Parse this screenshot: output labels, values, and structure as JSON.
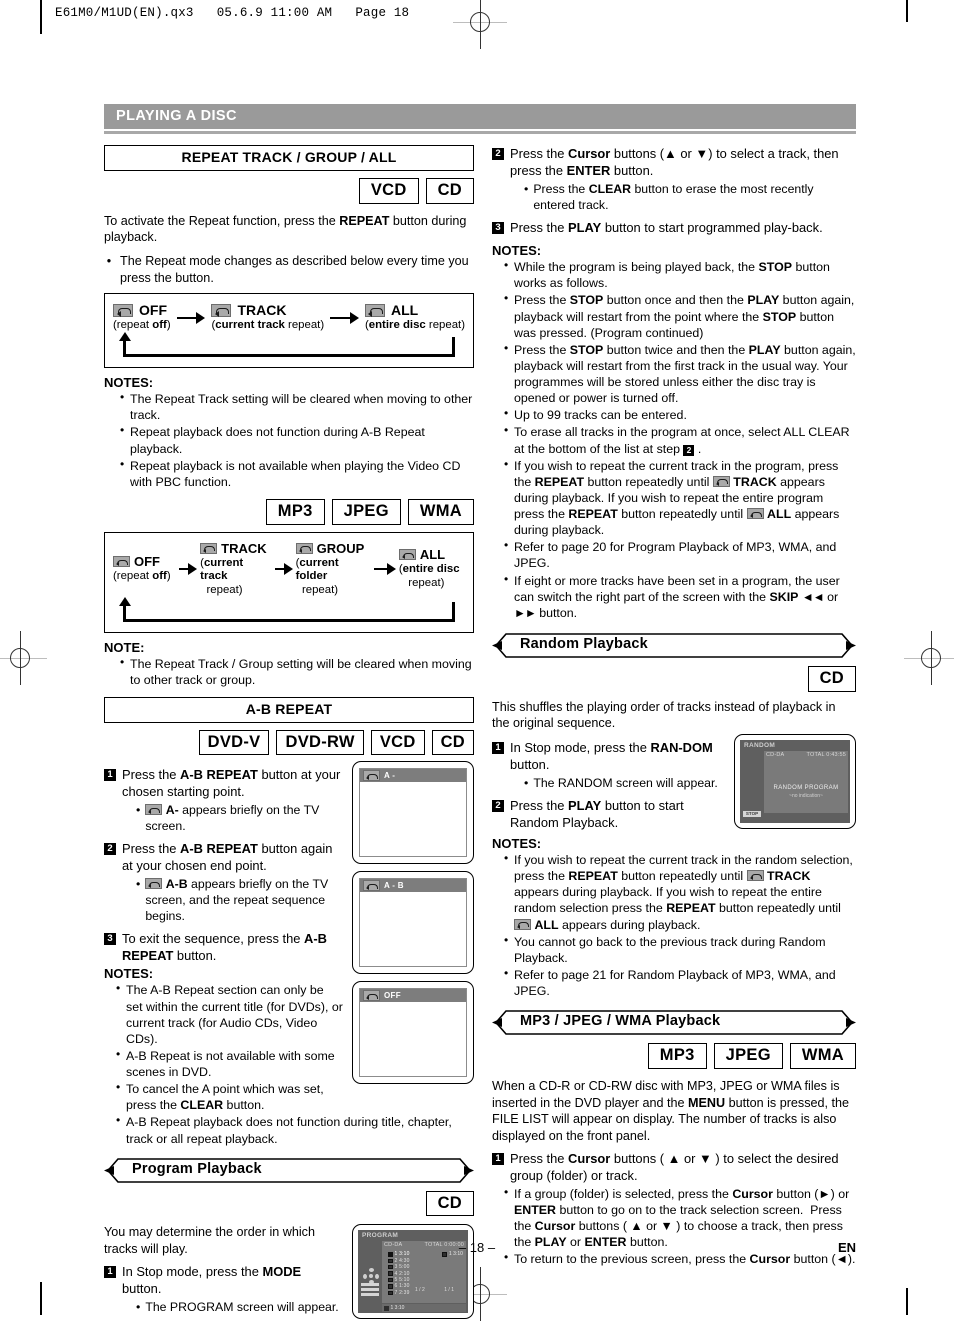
{
  "print_header": "E61M0/M1UD(EN).qx3   05.6.9 11:00 AM   Page 18",
  "section_bar": {
    "title": "PLAYING A DISC"
  },
  "footer": {
    "page_number": "– 18 –",
    "language": "EN"
  },
  "left_column": {
    "repeat": {
      "title": "REPEAT TRACK / GROUP / ALL",
      "chips": [
        "VCD",
        "CD"
      ],
      "intro_before": "To activate the Repeat function, press the ",
      "intro_bold": "REPEAT",
      "intro_after": " button during playback.",
      "bullet": "The Repeat mode changes as described below every time you press the button.",
      "flow_disc": [
        {
          "label": "OFF",
          "sub_bold": "",
          "sub_plain": "(repeat ",
          "sub_bold2": "off",
          "sub_tail": ")"
        },
        {
          "label": "TRACK",
          "sub_plain": "(",
          "sub_bold2": "current track",
          "sub_tail": " repeat)"
        },
        {
          "label": "ALL",
          "sub_plain": "(",
          "sub_bold2": "entire disc",
          "sub_tail": " repeat)"
        }
      ],
      "notes_label": "NOTES:",
      "notes": [
        "The Repeat Track setting will be cleared when moving to other track.",
        "Repeat playback does not function during A-B Repeat playback.",
        "Repeat playback is not available when playing the Video CD with PBC function."
      ],
      "chips2": [
        "MP3",
        "JPEG",
        "WMA"
      ],
      "flow_files": [
        {
          "label": "OFF",
          "sub_pre": "(repeat ",
          "sub_bold": "off",
          "sub_post": ")"
        },
        {
          "label": "TRACK",
          "sub_pre": "(",
          "sub_bold": "current track",
          "sub_post": " repeat)"
        },
        {
          "label": "GROUP",
          "sub_pre": "(",
          "sub_bold": "current folder",
          "sub_post": " repeat)"
        },
        {
          "label": "ALL",
          "sub_pre": "(",
          "sub_bold": "entire disc",
          "sub_post": " repeat)"
        }
      ],
      "note_label2": "NOTE:",
      "notes2": [
        "The Repeat Track / Group setting will be cleared when moving to other track or group."
      ]
    },
    "ab_repeat": {
      "title": "A-B REPEAT",
      "chips": [
        "DVD-V",
        "DVD-RW",
        "VCD",
        "CD"
      ],
      "steps": [
        {
          "no": "1",
          "text_parts": [
            "Press the ",
            "A-B REPEAT",
            " button at your chosen starting point."
          ],
          "sub": [
            "A- appears briefly on the TV screen."
          ]
        },
        {
          "no": "2",
          "text_parts": [
            "Press the ",
            "A-B REPEAT",
            " button again at your chosen end point."
          ],
          "sub": [
            "A-B appears briefly on the TV screen, and the repeat sequence begins."
          ]
        },
        {
          "no": "3",
          "text_parts": [
            "To exit the sequence, press the ",
            "A-B REPEAT",
            " button."
          ],
          "sub": []
        }
      ],
      "tv_screens": [
        "A -",
        "A - B",
        "OFF"
      ],
      "notes_label": "NOTES:",
      "notes": [
        "The A-B Repeat section can only be set within the current title (for DVDs), or current track (for Audio CDs, Video CDs).",
        "A-B Repeat is not available with some scenes in DVD.",
        "To cancel the A point which was set, press the CLEAR button.",
        "A-B Repeat playback does not function during title, chapter, track or all repeat playback."
      ]
    },
    "program_playback": {
      "heading": "Program Playback",
      "chips": [
        "CD"
      ],
      "intro": "You may determine the order in which tracks will play.",
      "step1_pre": "In Stop mode, press the ",
      "step1_bold": "MODE",
      "step1_post": " button.",
      "step1_sub": "The PROGRAM screen will appear.",
      "osd": {
        "title": "PROGRAM",
        "disc": "CD-DA",
        "total": "TOTAL   0:00:00",
        "tracks": [
          "1  3:10",
          "2  4:30",
          "3  5:00",
          "4  2:10",
          "5  5:10",
          "6  1:30",
          "7  2:39"
        ],
        "right_entry": "1   3:10",
        "page_left": "1 / 2",
        "page_right": "1 / 1",
        "footer_entry": "1   3:10"
      }
    }
  },
  "right_column": {
    "program_steps": [
      {
        "no": "2",
        "parts": [
          "Press the ",
          "Cursor",
          " buttons (▲ or ▼) to select a track, then press the ",
          "ENTER",
          " button."
        ],
        "sub": [
          "Press the CLEAR button to erase the most recently entered track."
        ]
      },
      {
        "no": "3",
        "parts": [
          "Press the ",
          "PLAY",
          " button to start programmed play-back."
        ],
        "sub": []
      }
    ],
    "program_notes_label": "NOTES:",
    "program_notes": [
      "While the program is being played back, the STOP button works as follows.",
      "Press the STOP button once and then the PLAY button again, playback will restart from the point where the STOP button was pressed. (Program continued)",
      "Press the STOP button twice and then the PLAY button again, playback will restart from the first track in the usual way. Your programmes will be stored unless either the disc tray is opened or power is turned off.",
      "Up to 99 tracks can be entered.",
      "To erase all tracks in the program at once, select ALL CLEAR at the bottom of the list at step 2 .",
      "If you wish to repeat the current track in the program, press the REPEAT button repeatedly until TRACK appears during playback. If you wish to repeat the entire program press the REPEAT button repeatedly until ALL appears during playback.",
      "Refer to page 20 for Program Playback of MP3, WMA, and JPEG.",
      "If eight or more tracks have been set in a program, the user can switch the right part of the screen with the SKIP ◄◄ or ►► button."
    ],
    "random_playback": {
      "heading": "Random Playback",
      "chips": [
        "CD"
      ],
      "intro": "This shuffles the playing order of tracks instead of playback in the original sequence.",
      "step1_pre": "In Stop mode, press the ",
      "step1_bold": "RAN-DOM",
      "step1_post": " button.",
      "step1_sub": "The RANDOM screen will appear.",
      "step2_pre": "Press the ",
      "step2_bold": "PLAY",
      "step2_post": " button to start Random Playback.",
      "osd": {
        "title": "RANDOM",
        "disc": "CD-DA",
        "total": "TOTAL   0:43:55",
        "center_line1": "RANDOM PROGRAM",
        "center_line2": "~no indication~",
        "stop_button": "STOP"
      },
      "notes_label": "NOTES:",
      "notes": [
        "If you wish to repeat the current track in the random selection, press the REPEAT button repeatedly until TRACK appears during playback. If you wish to repeat the entire random selection press the REPEAT button repeatedly until ALL appears during playback.",
        "You cannot go back to the previous track during Random Playback.",
        "Refer to page 21 for Random Playback of MP3, WMA, and JPEG."
      ]
    },
    "mp3_playback": {
      "heading": "MP3 / JPEG / WMA Playback",
      "chips": [
        "MP3",
        "JPEG",
        "WMA"
      ],
      "intro": "When a CD-R or CD-RW disc with MP3, JPEG or WMA files is inserted in the DVD player and the MENU button is pressed, the FILE LIST will appear on display. The number of tracks is also displayed on the front panel.",
      "step1_pre": "Press the ",
      "step1_bold": "Cursor",
      "step1_post": " buttons ( ▲ or ▼ ) to select the desired group (folder) or track.",
      "subs": [
        "If a group (folder) is selected, press the Cursor button (►) or ENTER button to go on to the track selection screen.  Press the Cursor buttons ( ▲ or ▼ ) to choose a track, then press the PLAY or ENTER button.",
        "To return to the previous screen, press the Cursor button (◄)."
      ]
    }
  }
}
